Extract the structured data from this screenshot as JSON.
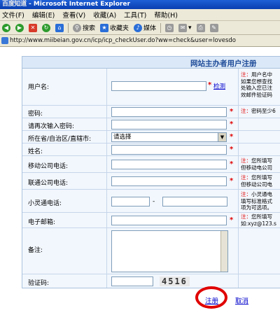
{
  "window": {
    "watermark": "百度知道",
    "title": "- Microsoft Internet Explorer"
  },
  "menu": [
    "文件(F)",
    "编辑(E)",
    "查看(V)",
    "收藏(A)",
    "工具(T)",
    "帮助(H)"
  ],
  "toolbar": {
    "search": "搜索",
    "favorites": "收藏夹",
    "media": "媒体"
  },
  "address": {
    "url": "http://www.miibeian.gov.cn/icp/icp_checkUser.do?ww=check&user=lovesdo"
  },
  "form": {
    "title": "网站主办者用户注册",
    "required_mark": "*",
    "username": {
      "label": "用户名:",
      "check_link": "检测"
    },
    "password": {
      "label": "密码:"
    },
    "password_confirm": {
      "label": "请再次输入密码:"
    },
    "province": {
      "label": "所在省/自治区/直辖市:",
      "selected": "请选择"
    },
    "name": {
      "label": "姓名:"
    },
    "mobile": {
      "label": "移动公司电话:"
    },
    "unicom": {
      "label": "联通公司电话:"
    },
    "phs": {
      "label": "小灵通电话:",
      "separator": "-"
    },
    "email": {
      "label": "电子邮箱:"
    },
    "remark": {
      "label": "备注:"
    },
    "captcha": {
      "label": "验证码:",
      "code": "4516"
    },
    "notes": {
      "username": [
        "注：用户名中",
        "如果您想查找",
        "处输入您已注",
        "效邮件验证码"
      ],
      "password": [
        "注：密码至少6"
      ],
      "mobile": [
        "注：您所填写",
        "但移动电公司"
      ],
      "unicom": [
        "注：您所填写",
        "但移动公司电"
      ],
      "phs": [
        "注：小灵通电",
        "填写标准格式",
        "项为可选项。"
      ],
      "email": [
        "注：您所填写",
        "如:xyz@123.s"
      ]
    },
    "register_button": "注册",
    "cancel_button": "取消"
  }
}
